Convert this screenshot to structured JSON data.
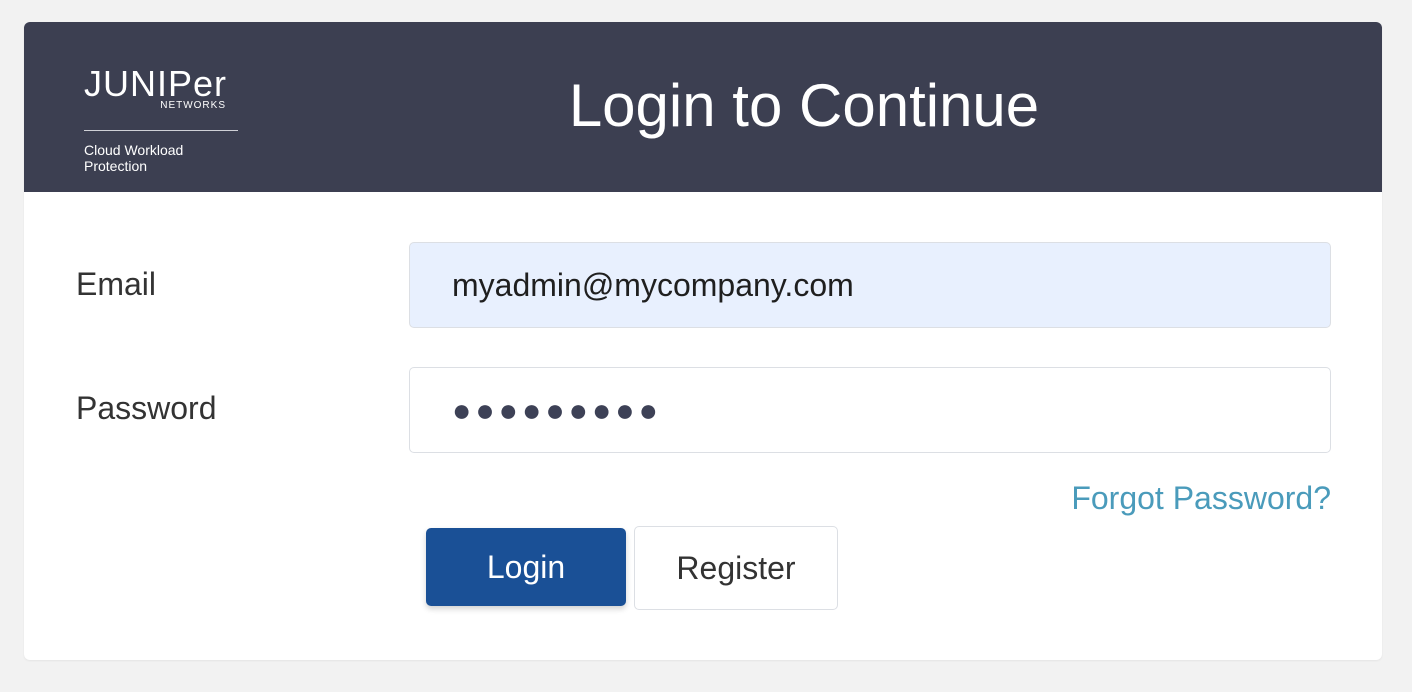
{
  "header": {
    "logo": {
      "wordmark": "JUNIPer",
      "sub": "NETWORKS",
      "product": "Cloud Workload Protection"
    },
    "title": "Login to Continue"
  },
  "form": {
    "email_label": "Email",
    "email_value": "myadmin@mycompany.com",
    "password_label": "Password",
    "password_value": "●●●●●●●●●",
    "forgot_link": "Forgot Password?",
    "login_button": "Login",
    "register_button": "Register"
  },
  "colors": {
    "header_bg": "#3c3f51",
    "primary": "#1a5096",
    "link": "#4a9bbb",
    "autofill_bg": "#e8f0fe"
  }
}
